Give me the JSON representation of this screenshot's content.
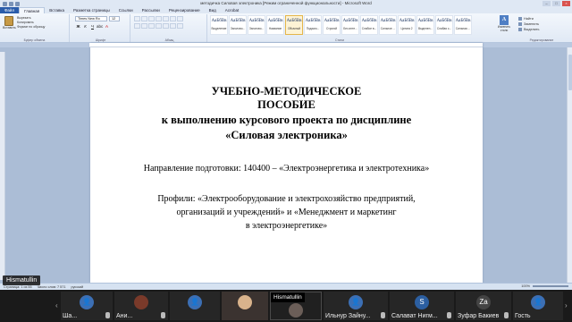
{
  "word": {
    "title": "методичка Силовая электроника [Режим ограниченной функциональности] - Microsoft Word",
    "tabs": [
      "Файл",
      "Главная",
      "Вставка",
      "Разметка страницы",
      "Ссылки",
      "Рассылки",
      "Рецензирование",
      "Вид",
      "Acrobat"
    ],
    "active_tab": "Главная",
    "clipboard": {
      "paste_label": "Вставить",
      "cut": "Вырезать",
      "copy": "Копировать",
      "format_painter": "Формат по образцу",
      "group_label": "Буфер обмена"
    },
    "font": {
      "name": "Times New Ro",
      "size": "12",
      "group_label": "Шрифт"
    },
    "paragraph_label": "Абзац",
    "styles": [
      {
        "sample": "АаБбВв",
        "name": "Выделение"
      },
      {
        "sample": "АаБбВв",
        "name": "Заголово..."
      },
      {
        "sample": "АаБбВв",
        "name": "Заголово..."
      },
      {
        "sample": "АаБбВв",
        "name": "Название"
      },
      {
        "sample": "АаБбВв",
        "name": "Обычный"
      },
      {
        "sample": "АаБбВв",
        "name": "Подзаго..."
      },
      {
        "sample": "АаБбВв",
        "name": "Строгий"
      },
      {
        "sample": "АаБбВв",
        "name": "Без инте..."
      },
      {
        "sample": "АаБбВв",
        "name": "Слабое в..."
      },
      {
        "sample": "АаБбВв",
        "name": "Сильное ..."
      },
      {
        "sample": "АаБбВв",
        "name": "Цитата 2"
      },
      {
        "sample": "АаБбВв",
        "name": "Выделен..."
      },
      {
        "sample": "АаБбВв",
        "name": "Слабая с..."
      },
      {
        "sample": "АаБбВв",
        "name": "Сильная ..."
      }
    ],
    "selected_style": "Обычный",
    "styles_label": "Стили",
    "change_styles": "Изменить стили",
    "editing": {
      "find": "Найти",
      "replace": "Заменить",
      "select": "Выделить",
      "group_label": "Редактирование"
    },
    "status": {
      "page": "Страница: 1 из 55",
      "words": "Число слов: 7 571",
      "lang": "русский"
    },
    "zoom": "100%"
  },
  "document": {
    "title_lines": [
      "УЧЕБНО-МЕТОДИЧЕСКОЕ",
      "ПОСОБИЕ",
      "к выполнению курсового проекта по дисциплине",
      "«Силовая электроника»"
    ],
    "direction": "Направление подготовки: 140400 – «Электроэнергетика и электротехника»",
    "profile_lines": [
      "Профили: «Электрооборудование и электрохозяйство предприятий,",
      "организаций и учреждений» и «Менеджмент и маркетинг",
      "в электроэнергетике»"
    ]
  },
  "speaker_label": "Hismatullin",
  "participants": [
    {
      "name": "Ша...",
      "initial": ""
    },
    {
      "name": "Ани...",
      "initial": ""
    },
    {
      "name": "",
      "initial": ""
    },
    {
      "name": "Hismatullin",
      "initial": ""
    },
    {
      "name": "Ильнур Зайну...",
      "initial": ""
    },
    {
      "name": "Салават Нигм...",
      "initial": "S"
    },
    {
      "name": "Зуфар Бакиев",
      "initial": "Za"
    },
    {
      "name": "Гость",
      "initial": ""
    }
  ],
  "colors": {
    "word_blue": "#2a5caa",
    "strip_bg": "#1a1a1a",
    "avatar_blue": "#3c6fb4"
  }
}
